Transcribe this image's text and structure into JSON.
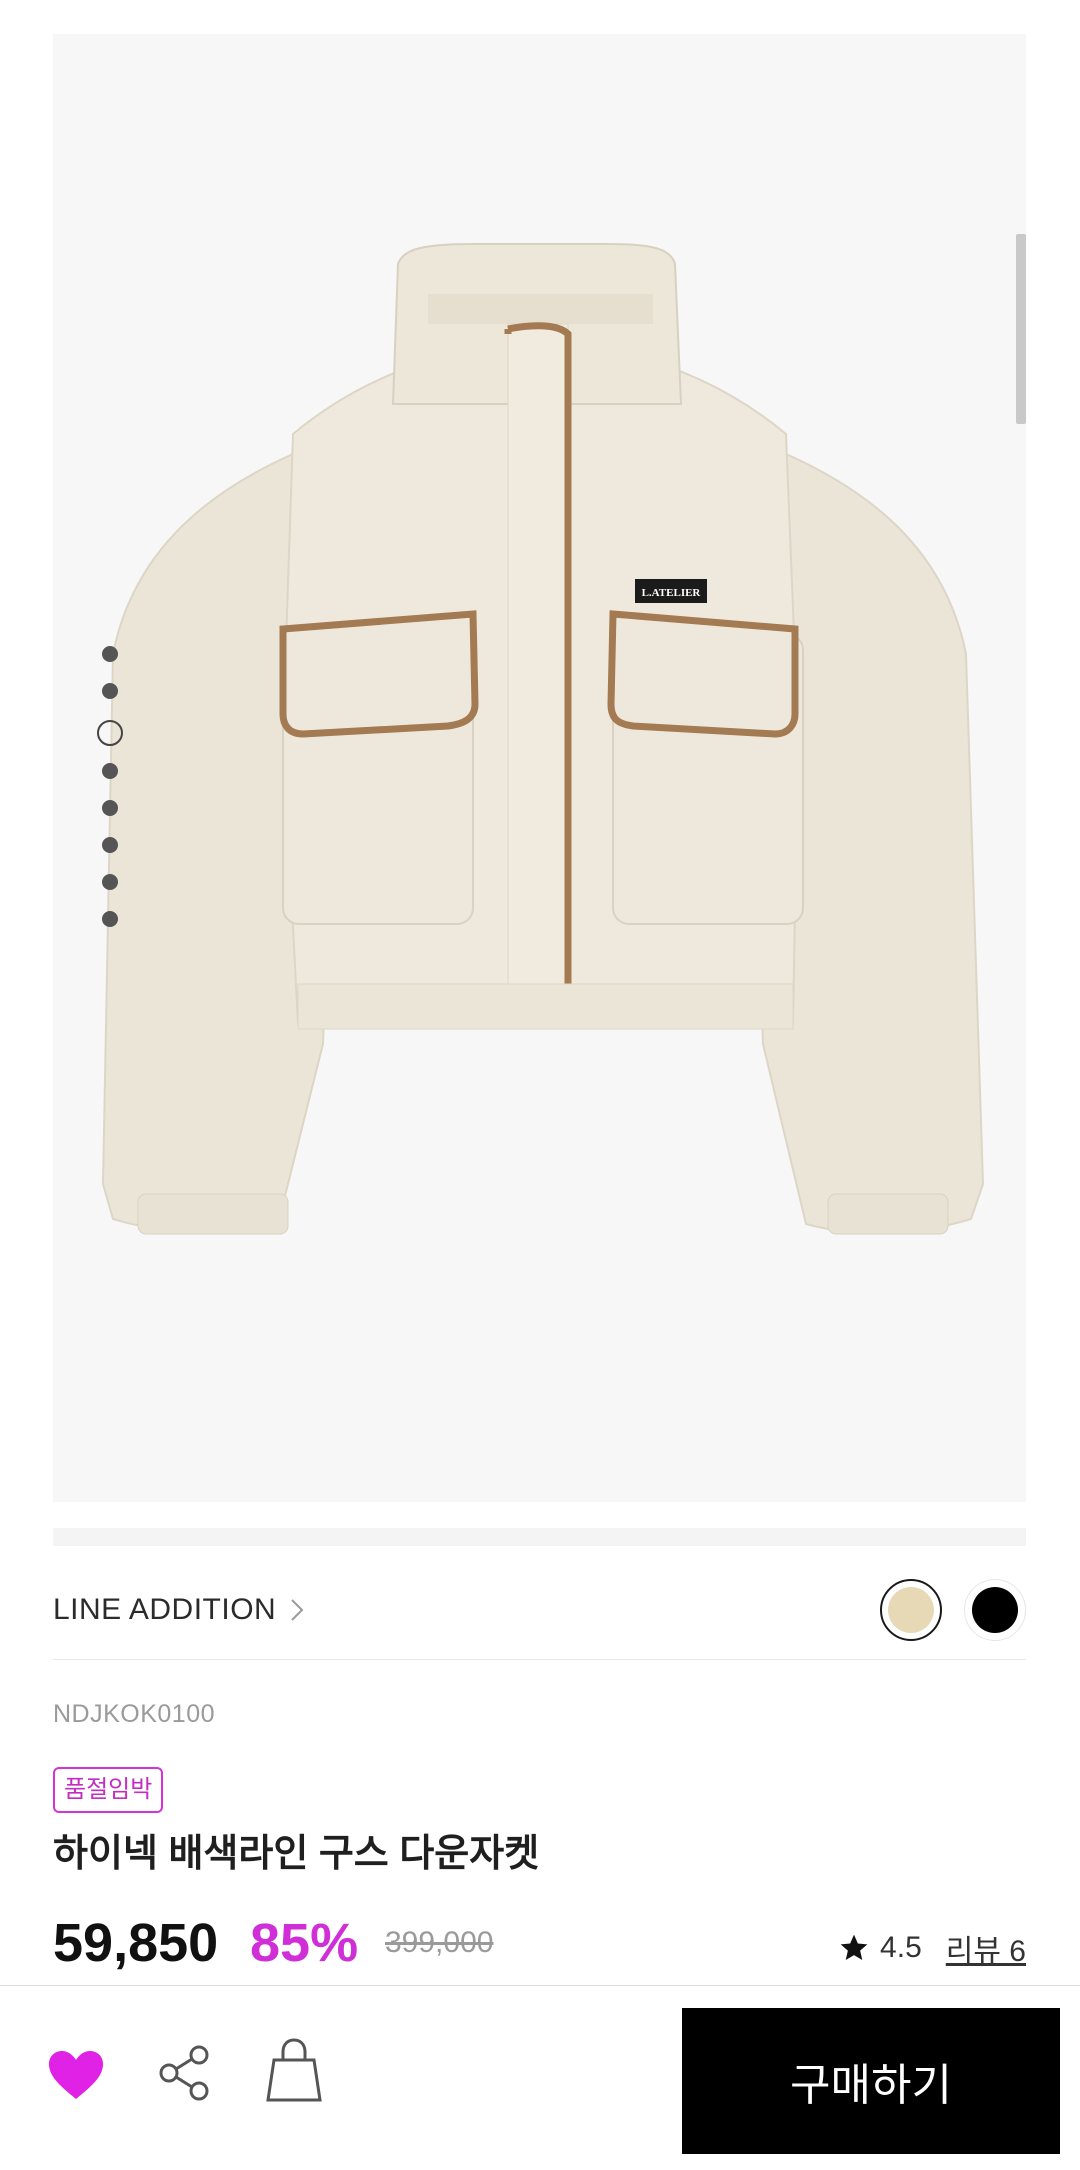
{
  "gallery": {
    "image_alt": "beige cropped down jacket",
    "label_text": "L.ATELIER",
    "slide_count": 8,
    "active_slide": 3
  },
  "line": {
    "label": "LINE ADDITION",
    "swatches": [
      {
        "name": "beige",
        "color": "#e7d9b6",
        "selected": true
      },
      {
        "name": "black",
        "color": "#000000",
        "selected": false
      }
    ]
  },
  "product": {
    "sku": "NDJKOK0100",
    "badge": "품절임박",
    "title": "하이넥 배색라인 구스 다운자켓",
    "price": "59,850",
    "discount": "85%",
    "original_price": "399,000",
    "rating": "4.5",
    "review_label": "리뷰 6"
  },
  "bottom_bar": {
    "wishlist_icon": "heart-icon",
    "share_icon": "share-icon",
    "cart_icon": "shopping-bag-icon",
    "buy_label": "구매하기",
    "heart_color": "#e022e6"
  },
  "colors": {
    "accent": "#d02ed6",
    "badge_border": "#d633d6"
  }
}
